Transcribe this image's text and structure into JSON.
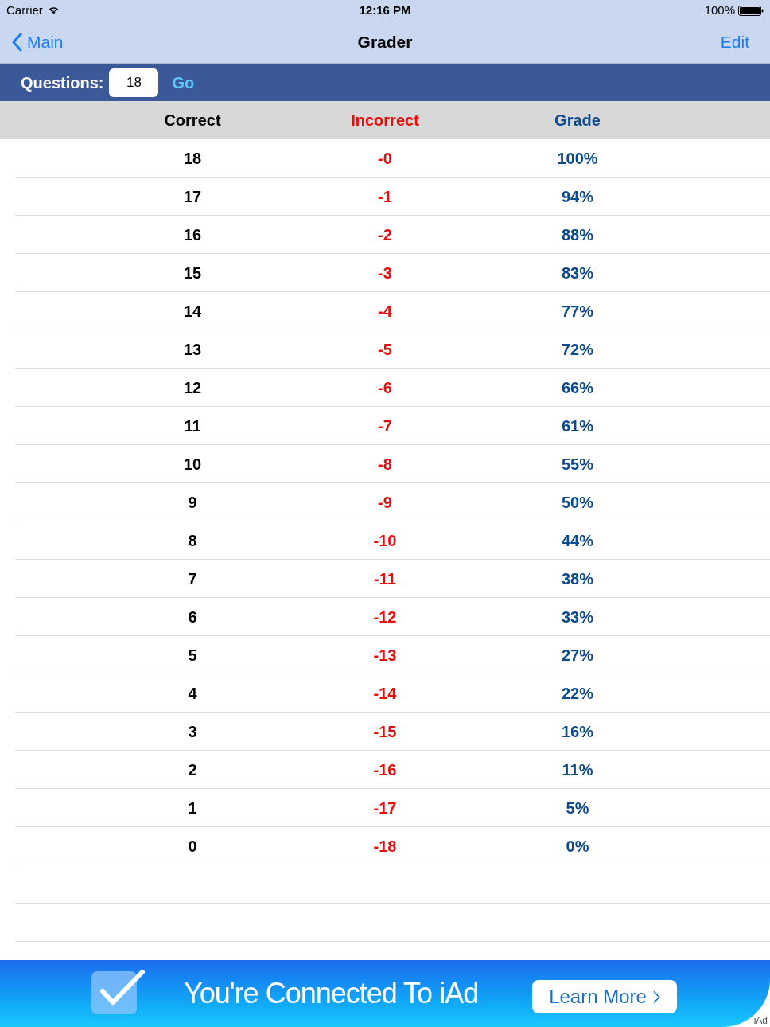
{
  "status_bar": {
    "carrier": "Carrier",
    "time": "12:16 PM",
    "battery": "100%"
  },
  "nav_bar": {
    "back": "Main",
    "title": "Grader",
    "action": "Edit"
  },
  "questions_bar": {
    "label": "Questions:",
    "value": "18",
    "button": "Go"
  },
  "table": {
    "columns": [
      "Correct",
      "Incorrect",
      "Grade"
    ],
    "rows": [
      [
        "18",
        "-0",
        "100%"
      ],
      [
        "17",
        "-1",
        "94%"
      ],
      [
        "16",
        "-2",
        "88%"
      ],
      [
        "15",
        "-3",
        "83%"
      ],
      [
        "14",
        "-4",
        "77%"
      ],
      [
        "13",
        "-5",
        "72%"
      ],
      [
        "12",
        "-6",
        "66%"
      ],
      [
        "11",
        "-7",
        "61%"
      ],
      [
        "10",
        "-8",
        "55%"
      ],
      [
        "9",
        "-9",
        "50%"
      ],
      [
        "8",
        "-10",
        "44%"
      ],
      [
        "7",
        "-11",
        "38%"
      ],
      [
        "6",
        "-12",
        "33%"
      ],
      [
        "5",
        "-13",
        "27%"
      ],
      [
        "4",
        "-14",
        "22%"
      ],
      [
        "3",
        "-15",
        "16%"
      ],
      [
        "2",
        "-16",
        "11%"
      ],
      [
        "1",
        "-17",
        "5%"
      ],
      [
        "0",
        "-18",
        "0%"
      ]
    ]
  },
  "ad_banner": {
    "headline": "You're Connected To iAd",
    "button": "Learn More",
    "badge": "iAd"
  }
}
